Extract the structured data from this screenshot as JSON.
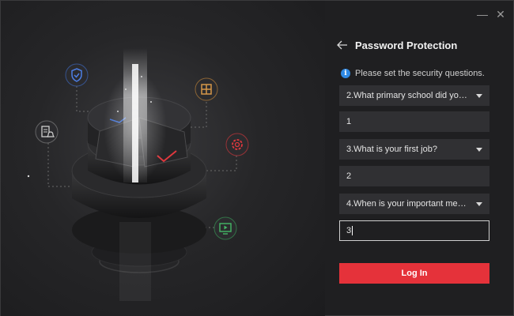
{
  "window": {
    "minimize_glyph": "—",
    "close_glyph": "✕"
  },
  "illustration": {
    "icons": [
      "shield-icon",
      "window-grid-icon",
      "document-bell-icon",
      "gear-icon",
      "monitor-play-icon"
    ],
    "icon_colors": {
      "shield": "#3f6fd1",
      "grid": "#c98a3a",
      "document": "#bfbfbf",
      "gear": "#e0383e",
      "monitor": "#3aa35a"
    }
  },
  "panel": {
    "title": "Password Protection",
    "info_text": "Please set the security questions.",
    "questions": [
      {
        "question": "2.What primary school did you ...",
        "answer": "1"
      },
      {
        "question": "3.What is your first job?",
        "answer": "2"
      },
      {
        "question": "4.When is your important mem...",
        "answer": "3"
      }
    ],
    "login_label": "Log In"
  },
  "colors": {
    "accent": "#e5323a",
    "info": "#2f8ae6",
    "panel_bg": "#1f1f21",
    "field_bg": "#303033"
  }
}
